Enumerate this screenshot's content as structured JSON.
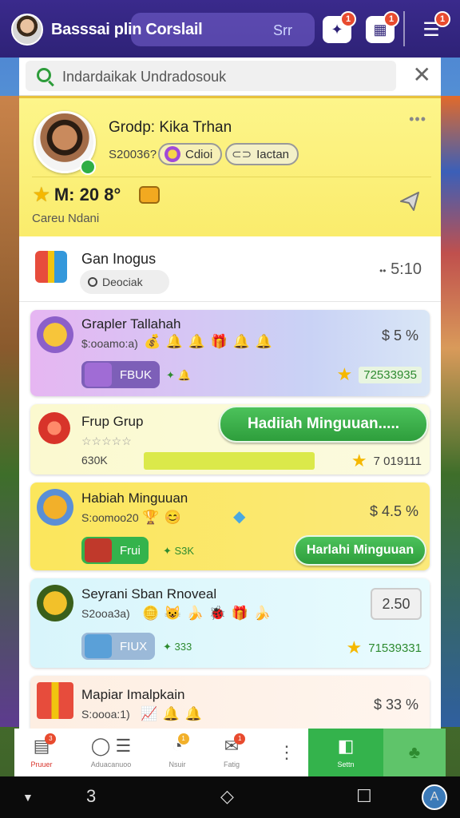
{
  "topbar": {
    "title": "Basssai plin Corslail",
    "pill_text": "Srr",
    "icons": [
      {
        "name": "bell-icon",
        "badge": "1"
      },
      {
        "name": "gift-icon",
        "badge": "1"
      },
      {
        "name": "menu-icon",
        "badge": "1"
      }
    ]
  },
  "search": {
    "value": "Indardaikak Undradosouk",
    "close_glyph": "✕"
  },
  "profile": {
    "name": "Grodp: Kika Trhan",
    "id": "S20036?",
    "chips": [
      "Cdioi",
      "Iactan"
    ],
    "level": "M: 20  8°",
    "subtitle": "Careu Ndani",
    "more": "•••"
  },
  "group_header": {
    "title": "Gan Inogus",
    "search_label": "Deociak",
    "time": "5:10",
    "time_prefix": "••"
  },
  "cards": [
    {
      "title": "Grapler Tallahah",
      "sub": "$:ooamo:a)",
      "stickers": "💰 🔔 🔔 🎁 🔔 🔔",
      "right": "$ 5 %",
      "tag": "FBUK",
      "tag_extra": "✦ 🔔",
      "score": "72533935",
      "colors": {
        "bg": "#e6b6f2",
        "accent": "#7d5fb8"
      }
    },
    {
      "title": "Frup Grup",
      "sub": "☆☆☆☆☆",
      "value": "630K",
      "button": "Hadiiah Minguuan.....",
      "score": "7 019111",
      "colors": {
        "bg": "#fbf9cf",
        "accent": "#34b34c"
      }
    },
    {
      "title": "Habiah Minguuan",
      "sub": "S:oomoo20",
      "stickers": "🏆 😊",
      "right": "$ 4.5 %",
      "tag": "Frui",
      "tag_extra": "✦ S3K",
      "button": "Harlahi Minguuan",
      "colors": {
        "bg": "#fbe65c",
        "accent": "#34b34c"
      }
    },
    {
      "title": "Seyrani Sban Rnoveal",
      "sub": "S2ooa3a)",
      "stickers": "🪙 😺 🍌 🐞 🎁 🍌",
      "value": "2.50",
      "tag": "FIUX",
      "tag_extra": "✦ 333",
      "score": "71539331",
      "colors": {
        "bg": "#d8f5fb",
        "accent": "#5aa0d8"
      }
    },
    {
      "title": "Mapiar Imalpkain",
      "sub": "S:oooa:1)",
      "stickers": "📈 🔔 🔔",
      "right": "$ 33 %",
      "colors": {
        "bg": "#fdeee2",
        "accent": "#e67e22"
      }
    }
  ],
  "bottom_nav": [
    {
      "label": "Pruuer",
      "icon": "calendar-icon",
      "badge": "3"
    },
    {
      "label": "Aduacanuoo",
      "icon": "chat-icon"
    },
    {
      "label": "Nsuir",
      "icon": "alert-icon",
      "badge": "1"
    },
    {
      "label": "Fatig",
      "icon": "mail-icon",
      "badge": "1"
    },
    {
      "label": "",
      "icon": "more-vertical-icon"
    },
    {
      "label": "Settn",
      "icon": "cube-icon"
    },
    {
      "label": "",
      "icon": "clover-icon"
    }
  ],
  "system_nav": {
    "back": "▼",
    "home_num": "3",
    "recents": "☐"
  }
}
